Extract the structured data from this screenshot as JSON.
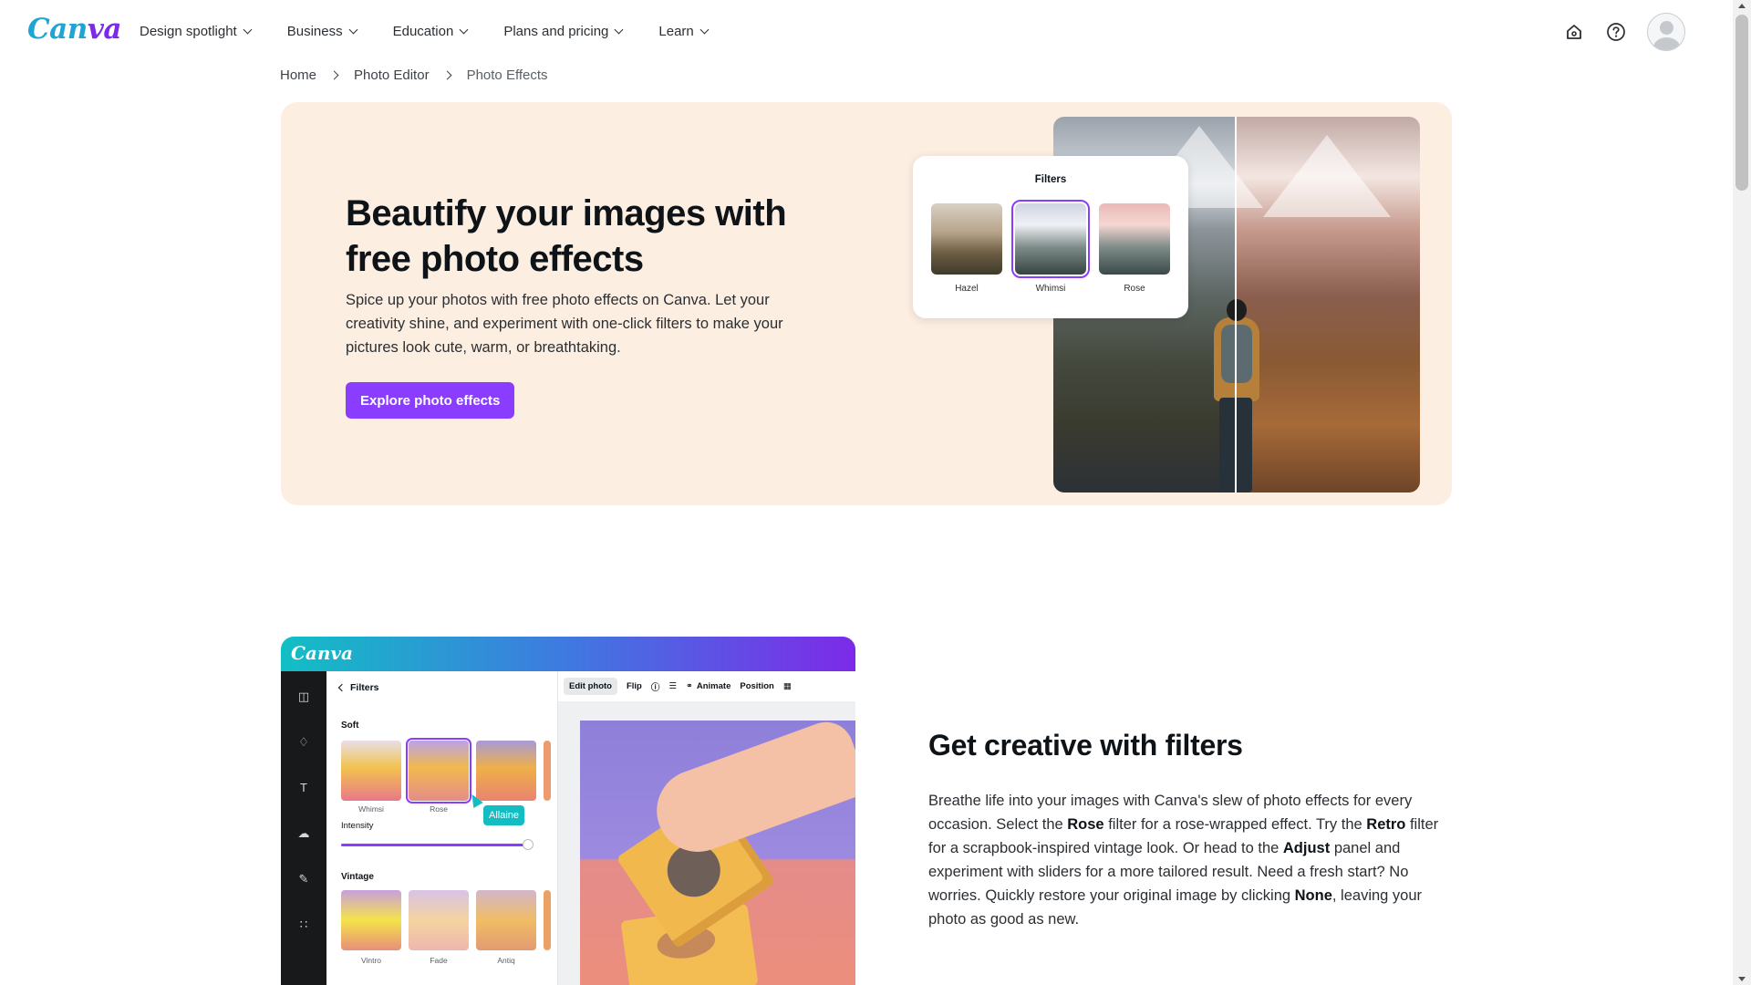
{
  "brand": {
    "logo_part1": "Can",
    "logo_part2": "va"
  },
  "nav": {
    "items": [
      {
        "label": "Design spotlight"
      },
      {
        "label": "Business"
      },
      {
        "label": "Education"
      },
      {
        "label": "Plans and pricing"
      },
      {
        "label": "Learn"
      }
    ]
  },
  "breadcrumb": {
    "home": "Home",
    "parent": "Photo Editor",
    "current": "Photo Effects"
  },
  "hero": {
    "title": "Beautify your images with free photo effects",
    "description": "Spice up your photos with free photo effects on Canva. Let your creativity shine, and experiment with one-click filters to make your pictures look cute, warm, or breathtaking.",
    "cta": "Explore photo effects",
    "filters_card": {
      "title": "Filters",
      "filters": [
        {
          "label": "Hazel"
        },
        {
          "label": "Whimsi",
          "selected": true
        },
        {
          "label": "Rose"
        }
      ]
    }
  },
  "feature": {
    "title": "Get creative with filters",
    "description_parts": [
      "Breathe life into your images with Canva's slew of photo effects for every occasion. Select the ",
      "Rose",
      " filter for a rose-wrapped effect. Try the ",
      "Retro",
      " filter for a scrapbook-inspired vintage look. Or head to the ",
      "Adjust",
      " panel and experiment with sliders for a more tailored result. Need a fresh start? No worries. Quickly restore your original image by clicking ",
      "None",
      ", leaving your photo as good as new."
    ],
    "mock": {
      "logo": "Canva",
      "panel_back": "Filters",
      "section_soft": "Soft",
      "soft_filters": [
        {
          "label": "Whimsi"
        },
        {
          "label": "Rose",
          "selected": true
        },
        {
          "label": ""
        }
      ],
      "intensity_label": "Intensity",
      "tooltip": "Allaine",
      "section_vintage": "Vintage",
      "vintage_filters": [
        {
          "label": "Vintro"
        },
        {
          "label": "Fade"
        },
        {
          "label": "Antiq"
        }
      ],
      "toolbar": {
        "edit_photo": "Edit photo",
        "flip": "Flip",
        "animate": "Animate",
        "position": "Position"
      }
    }
  },
  "colors": {
    "accent": "#8b3dff",
    "hero_bg": "#fdeee2",
    "tooltip": "#13bdc2"
  }
}
